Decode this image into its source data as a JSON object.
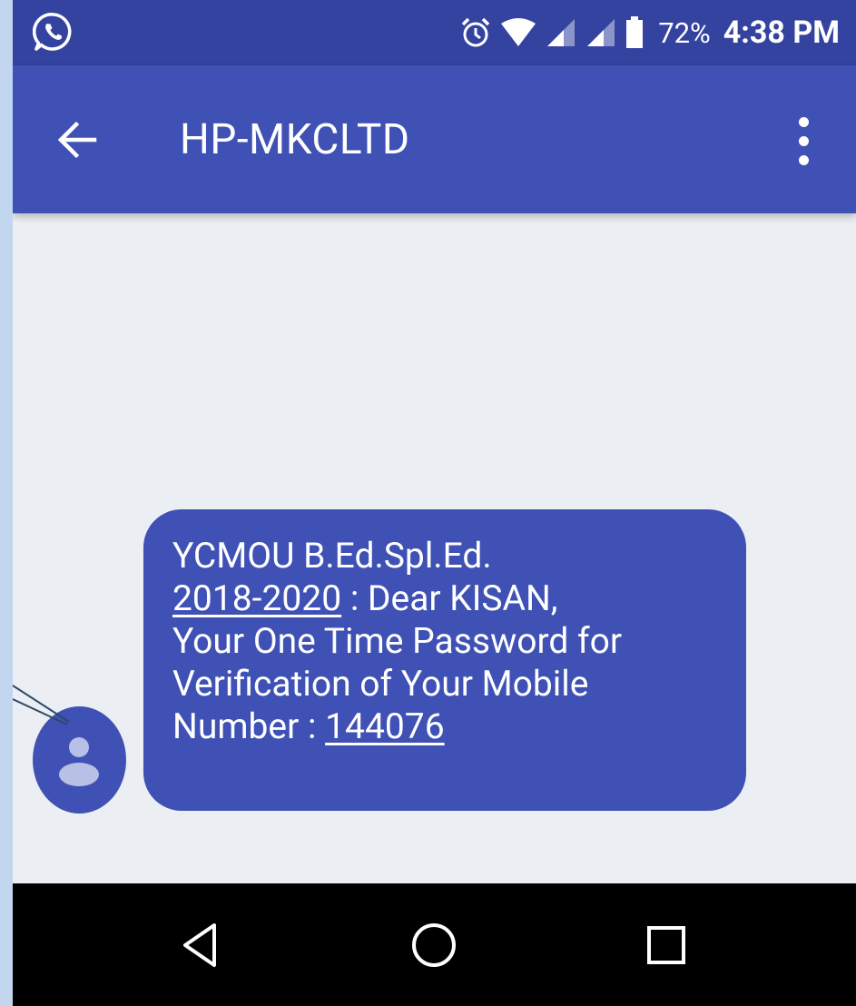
{
  "status_bar": {
    "icons": [
      "whatsapp-icon",
      "alarm-icon",
      "wifi-icon",
      "signal-icon",
      "signal-icon",
      "battery-icon"
    ],
    "battery_percent": "72%",
    "time": "4:38 PM"
  },
  "app_bar": {
    "title": "HP-MKCLTD",
    "back_icon": "arrow-back-icon",
    "menu_icon": "more-vert-icon"
  },
  "message": {
    "parts": [
      "YCMOU B.Ed.Spl.Ed.",
      "2018-2020",
      " : Dear KISAN,",
      "Your One Time Password for",
      "Verification of Your Mobile",
      "Number : ",
      "144076"
    ],
    "avatar_icon": "person-icon"
  },
  "nav_bar": {
    "icons": [
      "back-triangle-icon",
      "home-circle-icon",
      "recents-square-icon"
    ]
  },
  "colors": {
    "status_bar": "#3442a0",
    "app_bar": "#3f51b5",
    "bubble": "#3f51b5",
    "background": "#ebeef2",
    "nav_bar": "#000000"
  }
}
